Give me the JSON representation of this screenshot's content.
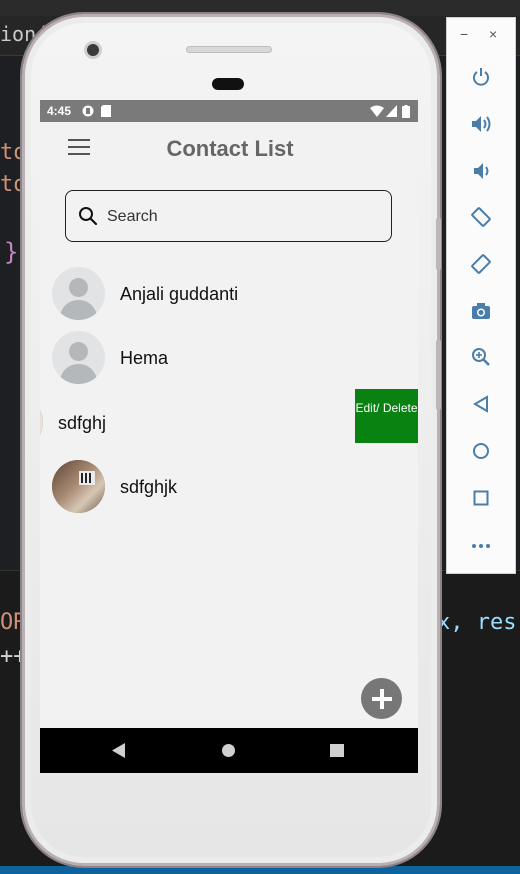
{
  "ide": {
    "tab_text": "ion(",
    "code_fragments": [
      "to",
      "to",
      "}"
    ],
    "bottom_left": "ORI",
    "bottom_left2": "++",
    "bottom_right": "x, res"
  },
  "status_bar": {
    "time": "4:45"
  },
  "app": {
    "title": "Contact List",
    "search_placeholder": "Search",
    "contacts": [
      {
        "name": "Anjali guddanti"
      },
      {
        "name": "Hema"
      },
      {
        "name": "sdfghj"
      },
      {
        "name": "sdfghjk"
      }
    ],
    "swipe_action_label": "Edit/ Delete"
  },
  "emulator_toolbar": {
    "minimize": "−",
    "close": "×",
    "buttons": [
      "power-icon",
      "volume-up-icon",
      "volume-down-icon",
      "rotate-left-icon",
      "rotate-right-icon",
      "camera-icon",
      "zoom-icon",
      "back-icon",
      "home-icon",
      "overview-icon",
      "more-icon"
    ]
  },
  "colors": {
    "swipe_action": "#0a8211",
    "fab": "#777777",
    "status_bar": "#7a7a7a",
    "emulator_icon": "#4a7ea8"
  }
}
